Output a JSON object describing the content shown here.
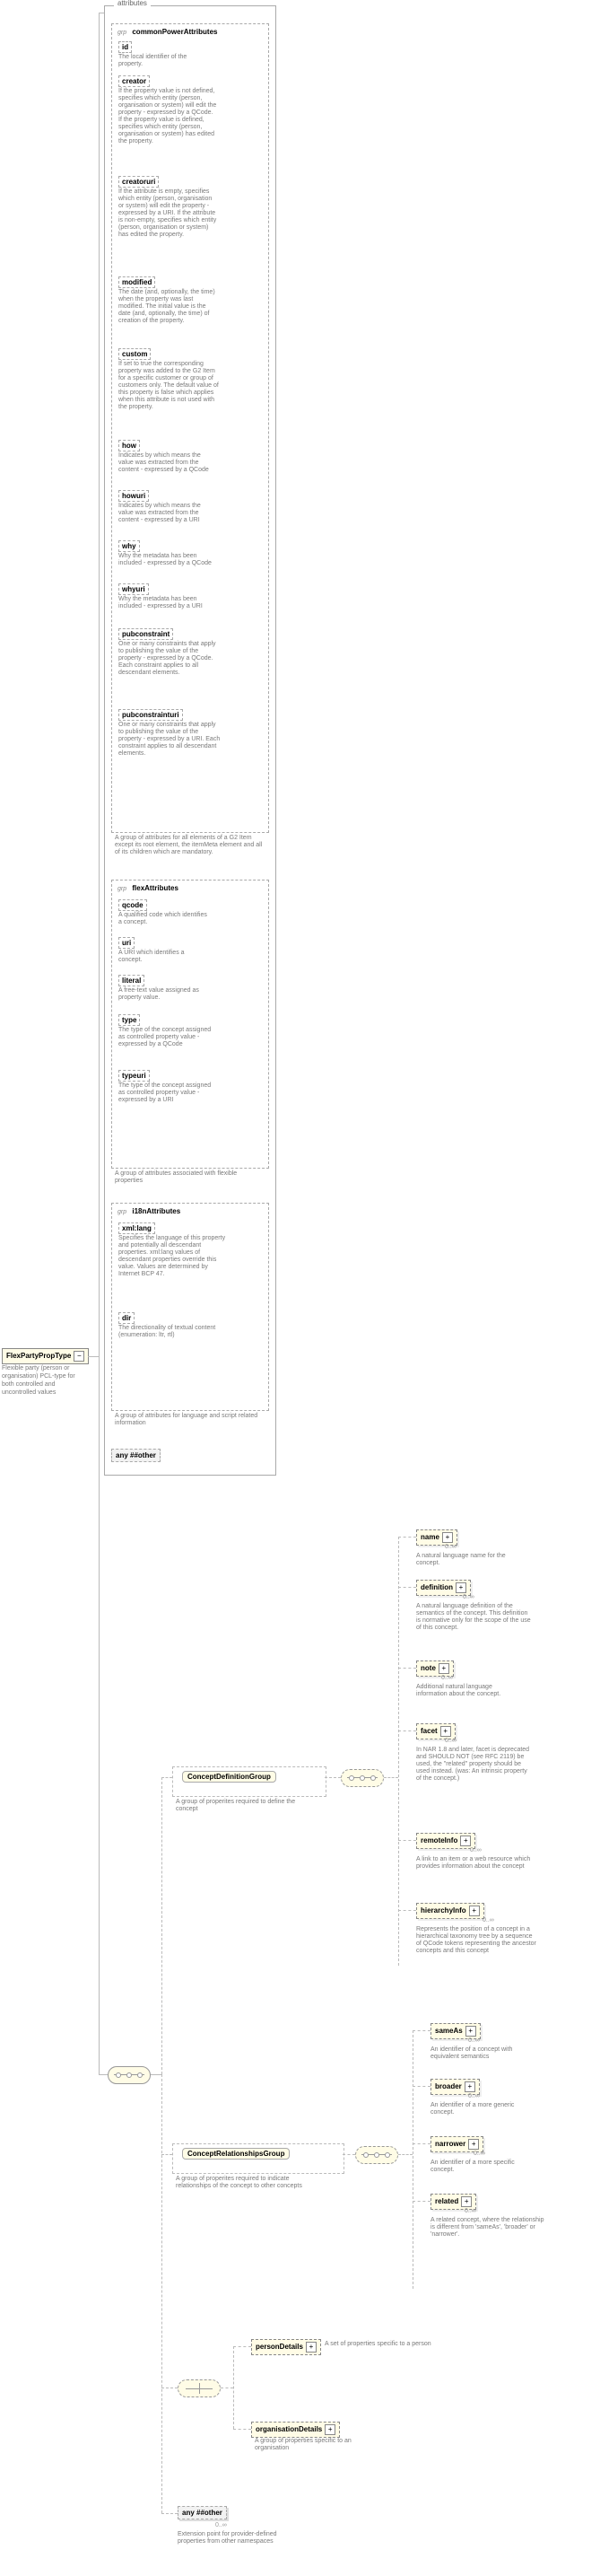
{
  "root": {
    "name": "FlexPartyPropType",
    "desc": "Flexible party (person or organisation) PCL-type for both controlled and uncontrolled values"
  },
  "attrPanelTitle": "attributes",
  "groups": {
    "common": {
      "label": "commonPowerAttributes",
      "desc": "A group of attributes for all elements of a G2 Item except its root element, the itemMeta element and all of its children which are mandatory."
    },
    "flex": {
      "label": "flexAttributes",
      "desc": "A group of attributes associated with flexible properties"
    },
    "i18n": {
      "label": "i18nAttributes",
      "desc": "A group of attributes for language and script related information"
    }
  },
  "grp_tag": "grp",
  "attrs": {
    "id": {
      "name": "id",
      "desc": "The local identifier of the property."
    },
    "creator": {
      "name": "creator",
      "desc": "If the property value is not defined, specifies which entity (person, organisation or system) will edit the property - expressed by a QCode. If the property value is defined, specifies which entity (person, organisation or system) has edited the property."
    },
    "creatoruri": {
      "name": "creatoruri",
      "desc": "If the attribute is empty, specifies which entity (person, organisation or system) will edit the property - expressed by a URI. If the attribute is non-empty, specifies which entity (person, organisation or system) has edited the property."
    },
    "modified": {
      "name": "modified",
      "desc": "The date (and, optionally, the time) when the property was last modified. The initial value is the date (and, optionally, the time) of creation of the property."
    },
    "custom": {
      "name": "custom",
      "desc": "If set to true the corresponding property was added to the G2 Item for a specific customer or group of customers only. The default value of this property is false which applies when this attribute is not used with the property."
    },
    "how": {
      "name": "how",
      "desc": "Indicates by which means the value was extracted from the content - expressed by a QCode"
    },
    "howuri": {
      "name": "howuri",
      "desc": "Indicates by which means the value was extracted from the content - expressed by a URI"
    },
    "why": {
      "name": "why",
      "desc": "Why the metadata has been included - expressed by a QCode"
    },
    "whyuri": {
      "name": "whyuri",
      "desc": "Why the metadata has been included - expressed by a URI"
    },
    "pubconstraint": {
      "name": "pubconstraint",
      "desc": "One or many constraints that apply to publishing the value of the property - expressed by a QCode. Each constraint applies to all descendant elements."
    },
    "pubconstrainturi": {
      "name": "pubconstrainturi",
      "desc": "One or many constraints that apply to publishing the value of the property - expressed by a URI. Each constraint applies to all descendant elements."
    },
    "qcode": {
      "name": "qcode",
      "desc": "A qualified code which identifies a concept."
    },
    "uri": {
      "name": "uri",
      "desc": "A URI which identifies a concept."
    },
    "literal": {
      "name": "literal",
      "desc": "A free-text value assigned as property value."
    },
    "type": {
      "name": "type",
      "desc": "The type of the concept assigned as controlled property value - expressed by a QCode"
    },
    "typeuri": {
      "name": "typeuri",
      "desc": "The type of the concept assigned as controlled property value - expressed by a URI"
    },
    "xmllang": {
      "name": "xml:lang",
      "desc": "Specifies the language of this property and potentially all descendant properties. xml:lang values of descendant properties override this value. Values are determined by Internet BCP 47."
    },
    "dir": {
      "name": "dir",
      "desc": "The directionality of textual content (enumeration: ltr, rtl)"
    }
  },
  "anyAttr": "any ##other",
  "cdg": {
    "label": "ConceptDefinitionGroup",
    "desc": "A group of properites required to define the concept"
  },
  "crg": {
    "label": "ConceptRelationshipsGroup",
    "desc": "A group of properites required to indicate relationships of the concept to other concepts"
  },
  "elems": {
    "name": {
      "name": "name",
      "desc": "A natural language name for the concept."
    },
    "definition": {
      "name": "definition",
      "desc": "A natural language definition of the semantics of the concept. This definition is normative only for the scope of the use of this concept."
    },
    "note": {
      "name": "note",
      "desc": "Additional natural language information about the concept."
    },
    "facet": {
      "name": "facet",
      "desc": "In NAR 1.8 and later, facet is deprecated and SHOULD NOT (see RFC 2119) be used, the \"related\" property should be used instead. (was: An intrinsic property of the concept.)"
    },
    "remoteInfo": {
      "name": "remoteInfo",
      "desc": "A link to an item or a web resource which provides information about the concept"
    },
    "hierarchyInfo": {
      "name": "hierarchyInfo",
      "desc": "Represents the position of a concept in a hierarchical taxonomy tree by a sequence of QCode tokens representing the ancestor concepts and this concept"
    },
    "sameAs": {
      "name": "sameAs",
      "desc": "An identifier of a concept with equivalent semantics"
    },
    "broader": {
      "name": "broader",
      "desc": "An identifier of a more generic concept."
    },
    "narrower": {
      "name": "narrower",
      "desc": "An identifier of a more specific concept."
    },
    "related": {
      "name": "related",
      "desc": "A related concept, where the relationship is different from 'sameAs', 'broader' or 'narrower'."
    },
    "personDetails": {
      "name": "personDetails",
      "desc": "A set of properties specific to a person"
    },
    "organisationDetails": {
      "name": "organisationDetails",
      "desc": "A group of properties specific to an organisation"
    }
  },
  "anyElem": "any ##other",
  "anyElemDesc": "Extension point for provider-defined properties from other namespaces",
  "card0inf": "0..∞"
}
